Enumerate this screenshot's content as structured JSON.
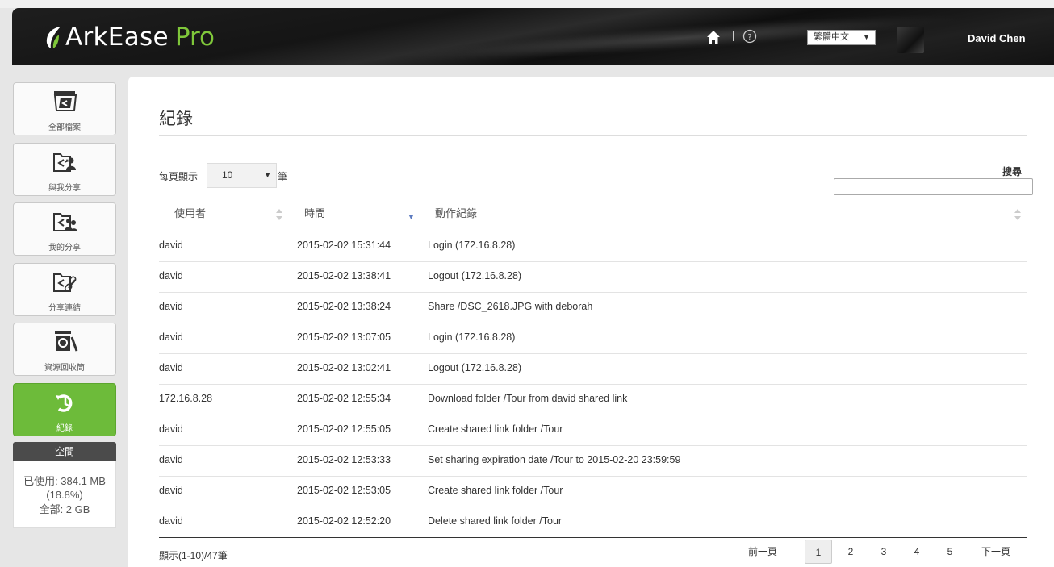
{
  "header": {
    "app_name": "ArkEase",
    "app_suffix": "Pro",
    "language": "繁體中文",
    "user_name": "David Chen"
  },
  "sidebar": {
    "items": [
      {
        "label": "全部檔案",
        "icon": "folder-icon"
      },
      {
        "label": "與我分享",
        "icon": "shared-with-me-icon"
      },
      {
        "label": "我的分享",
        "icon": "my-shares-icon"
      },
      {
        "label": "分享連結",
        "icon": "share-link-icon"
      },
      {
        "label": "資源回收筒",
        "icon": "recycle-bin-icon"
      },
      {
        "label": "紀錄",
        "icon": "history-icon",
        "active": true
      }
    ],
    "space": {
      "title": "空間",
      "used": "已使用: 384.1 MB",
      "used_pct": "(18.8%)",
      "total": "全部: 2 GB"
    }
  },
  "main": {
    "title": "紀錄",
    "per_page_label": "每頁顯示",
    "per_page_value": "10",
    "per_page_unit": "筆",
    "search_label": "搜尋",
    "columns": [
      "使用者",
      "時間",
      "動作紀錄"
    ],
    "rows": [
      {
        "user": "david",
        "time": "2015-02-02 15:31:44",
        "action": "Login (172.16.8.28)"
      },
      {
        "user": "david",
        "time": "2015-02-02 13:38:41",
        "action": "Logout (172.16.8.28)"
      },
      {
        "user": "david",
        "time": "2015-02-02 13:38:24",
        "action": "Share /DSC_2618.JPG with deborah"
      },
      {
        "user": "david",
        "time": "2015-02-02 13:07:05",
        "action": "Login (172.16.8.28)"
      },
      {
        "user": "david",
        "time": "2015-02-02 13:02:41",
        "action": "Logout (172.16.8.28)"
      },
      {
        "user": "172.16.8.28",
        "time": "2015-02-02 12:55:34",
        "action": "Download folder /Tour from david shared link"
      },
      {
        "user": "david",
        "time": "2015-02-02 12:55:05",
        "action": "Create shared link folder /Tour"
      },
      {
        "user": "david",
        "time": "2015-02-02 12:53:33",
        "action": "Set sharing expiration date /Tour to 2015-02-20 23:59:59"
      },
      {
        "user": "david",
        "time": "2015-02-02 12:53:05",
        "action": "Create shared link folder /Tour"
      },
      {
        "user": "david",
        "time": "2015-02-02 12:52:20",
        "action": "Delete shared link folder /Tour"
      }
    ],
    "footer_info": "顯示(1-10)/47筆",
    "pagination": {
      "prev": "前一頁",
      "pages": [
        "1",
        "2",
        "3",
        "4",
        "5"
      ],
      "current": "1",
      "next": "下一頁"
    }
  },
  "colors": {
    "accent_green": "#6dbb3a",
    "header_dark": "#1a1a1a",
    "sort_arrow": "#5d7bc0"
  }
}
